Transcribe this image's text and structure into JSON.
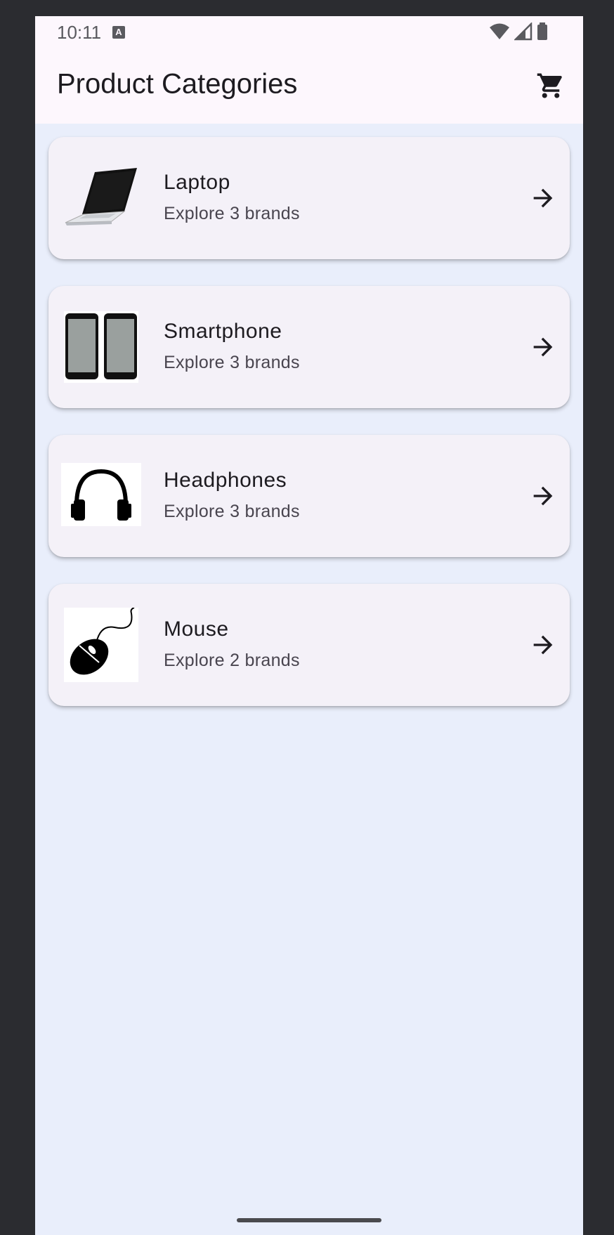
{
  "status_bar": {
    "time": "10:11",
    "notification_icon": "keyboard-a-icon",
    "icons": [
      "wifi-icon",
      "signal-icon",
      "battery-icon"
    ]
  },
  "app_bar": {
    "title": "Product Categories",
    "action_icon": "shopping-cart-icon"
  },
  "categories": [
    {
      "title": "Laptop",
      "subtitle": "Explore 3 brands",
      "image": "laptop-image"
    },
    {
      "title": "Smartphone",
      "subtitle": "Explore 3 brands",
      "image": "smartphone-image"
    },
    {
      "title": "Headphones",
      "subtitle": "Explore 3 brands",
      "image": "headphones-image"
    },
    {
      "title": "Mouse",
      "subtitle": "Explore 2 brands",
      "image": "mouse-image"
    }
  ],
  "colors": {
    "background": "#e9eefb",
    "app_bar": "#fdf7fd",
    "card": "#f4f1f8",
    "text_primary": "#1d1b20",
    "text_secondary": "#49454f"
  }
}
